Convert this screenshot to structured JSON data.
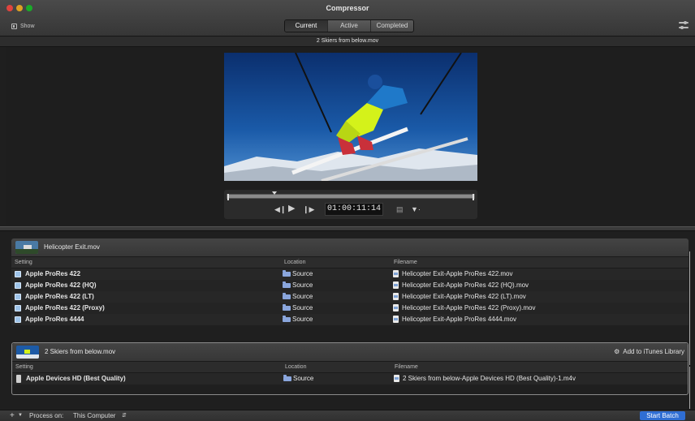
{
  "window": {
    "title": "Compressor"
  },
  "toolbar": {
    "show_label": "Show",
    "tabs": [
      {
        "label": "Current",
        "active": true
      },
      {
        "label": "Active",
        "active": false
      },
      {
        "label": "Completed",
        "active": false
      }
    ]
  },
  "preview": {
    "filename": "2 Skiers from below.mov",
    "timecode": "01:00:11:14",
    "playhead_fraction": 0.18
  },
  "jobs": [
    {
      "name": "Helicopter Exit.mov",
      "columns": [
        "Setting",
        "Location",
        "Filename"
      ],
      "rows": [
        {
          "setting": "Apple ProRes 422",
          "location": "Source",
          "filename": "Helicopter Exit-Apple ProRes 422.mov"
        },
        {
          "setting": "Apple ProRes 422 (HQ)",
          "location": "Source",
          "filename": "Helicopter Exit-Apple ProRes 422 (HQ).mov"
        },
        {
          "setting": "Apple ProRes 422 (LT)",
          "location": "Source",
          "filename": "Helicopter Exit-Apple ProRes 422 (LT).mov"
        },
        {
          "setting": "Apple ProRes 422 (Proxy)",
          "location": "Source",
          "filename": "Helicopter Exit-Apple ProRes 422 (Proxy).mov"
        },
        {
          "setting": "Apple ProRes 4444",
          "location": "Source",
          "filename": "Helicopter Exit-Apple ProRes 4444.mov"
        }
      ]
    },
    {
      "name": "2 Skiers from below.mov",
      "action_label": "Add to iTunes Library",
      "columns": [
        "Setting",
        "Location",
        "Filename"
      ],
      "rows": [
        {
          "setting": "Apple Devices HD (Best Quality)",
          "location": "Source",
          "filename": "2 Skiers from below-Apple Devices HD (Best Quality)-1.m4v"
        }
      ]
    }
  ],
  "bottom": {
    "add_symbol": "+",
    "process_label": "Process on:",
    "process_value": "This Computer",
    "start_label": "Start Batch"
  },
  "colors": {
    "accent": "#2f6ed3",
    "background": "#1f1f1f"
  }
}
